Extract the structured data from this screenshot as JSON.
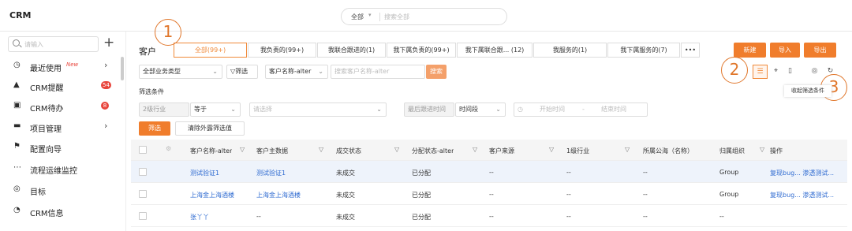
{
  "app": {
    "logo": "CRM"
  },
  "global_search": {
    "scope": "全部",
    "caret": "▾",
    "placeholder": "搜索全部"
  },
  "sidebar": {
    "search_placeholder": "请输入",
    "add": "+",
    "items": [
      {
        "label": "最近使用",
        "icon": "clock-icon",
        "glyph": "◷",
        "new": "New",
        "arrow": "›"
      },
      {
        "label": "CRM提醒",
        "icon": "bell-icon",
        "glyph": "▲",
        "badge": "54"
      },
      {
        "label": "CRM待办",
        "icon": "todo-icon",
        "glyph": "▣",
        "badge": "8"
      },
      {
        "label": "项目管理",
        "icon": "folder-icon",
        "glyph": "▬",
        "arrow": "›"
      },
      {
        "label": "配置向导",
        "icon": "flag-icon",
        "glyph": "⚑"
      },
      {
        "label": "流程运维监控",
        "icon": "flow-icon",
        "glyph": "⋯"
      },
      {
        "label": "目标",
        "icon": "target-icon",
        "glyph": "◎"
      },
      {
        "label": "CRM信息",
        "icon": "pie-icon",
        "glyph": "◔"
      }
    ]
  },
  "main": {
    "title": "客户",
    "tabs": [
      {
        "label": "全部(99+)",
        "active": true
      },
      {
        "label": "我负责的(99+)"
      },
      {
        "label": "我联合跟进的(1)"
      },
      {
        "label": "我下属负责的(99+)"
      },
      {
        "label": "我下属联合跟... (12)"
      },
      {
        "label": "我服务的(1)"
      },
      {
        "label": "我下属服务的(7)"
      },
      {
        "label": "•••"
      }
    ],
    "actions": {
      "new": "新建",
      "import": "导入",
      "export": "导出"
    },
    "filter_bar": {
      "type_select": "全部业务类型",
      "filter_button": "筛选",
      "field_select": "客户名称-alter",
      "search_placeholder": "搜索客户名称-alter",
      "search_button": "搜索"
    },
    "conditions": {
      "label": "筛选条件",
      "field1": "2级行业",
      "op1": "等于",
      "value1_placeholder": "请选择",
      "field2": "最后跟进时间",
      "op2": "时间段",
      "start_placeholder": "开始时间",
      "dash": "-",
      "end_placeholder": "结束时间",
      "apply": "筛选",
      "clear": "清除外露筛选值"
    },
    "collapse_tooltip": "收起筛选条件",
    "callouts": [
      "1",
      "2",
      "3"
    ],
    "table": {
      "headers": [
        "客户名称-alter",
        "客户主数据",
        "成交状态",
        "分配状态-alter",
        "客户来源",
        "1级行业",
        "所属公海（名称）",
        "归属组织",
        "操作"
      ],
      "rows": [
        {
          "name": "测试验证1",
          "master": "测试验证1",
          "deal": "未成交",
          "assign": "已分配",
          "source": "--",
          "industry": "--",
          "pool": "--",
          "org": "Group",
          "ops": "复现bug... 渗透测试..."
        },
        {
          "name": "上海金上海酒楼",
          "master": "上海金上海酒楼",
          "deal": "未成交",
          "assign": "已分配",
          "source": "--",
          "industry": "--",
          "pool": "--",
          "org": "Group",
          "ops": "复现bug... 渗透测试..."
        },
        {
          "name": "张丫丫",
          "master": "--",
          "deal": "未成交",
          "assign": "已分配",
          "source": "--",
          "industry": "--",
          "pool": "--",
          "org": "--",
          "ops": ""
        }
      ]
    }
  }
}
